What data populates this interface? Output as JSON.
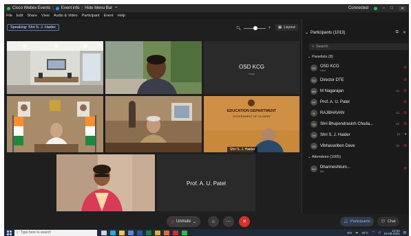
{
  "titlebar": {
    "app_title": "Cisco Webex Events",
    "event_info": "Event info",
    "hide_menu": "Hide Menu Bar",
    "status": "Connected",
    "minimize": "–",
    "maximize": "□",
    "close": "✕"
  },
  "menu": [
    "File",
    "Edit",
    "Share",
    "View",
    "Audio & Video",
    "Participant",
    "Event",
    "Help"
  ],
  "speaking": "Speaking: Shri S. J. Haider",
  "layout_label": "Layout",
  "tiles": {
    "osd_name": "OSD KCG",
    "osd_sub": "Host",
    "edu_line1": "EDUCATION DEPARTMENT",
    "edu_line2": "GOVERNMENT OF GUJARAT",
    "haider_tag": "Shri S. J. Haider",
    "patel_name": "Prof. A. U. Patel"
  },
  "participants": {
    "title": "Participants (1013)",
    "search_placeholder": "Search",
    "panelists_title": "Panelists (8)",
    "attendees_title": "Attendees (1005)",
    "panelists": [
      {
        "initials": "OK",
        "name": "OSD KCG",
        "sub": "Host"
      },
      {
        "initials": "DD",
        "name": "Director DTE",
        "sub": ""
      },
      {
        "initials": "MN",
        "name": "M Nagarajan",
        "sub": ""
      },
      {
        "initials": "PP",
        "name": "Prof. A. U. Patel",
        "sub": ""
      },
      {
        "initials": "R",
        "name": "RAJBHAVAN",
        "sub": ""
      },
      {
        "initials": "SS",
        "name": "Shri Bhupendrasinh Chuda...",
        "sub": ""
      },
      {
        "initials": "SH",
        "name": "Shri S. J. Haider",
        "sub": ""
      },
      {
        "initials": "VD",
        "name": "Vibhavariben Dave",
        "sub": ""
      }
    ],
    "attendees": [
      {
        "initials": "DY",
        "name": "Dharmeshkum...",
        "sub": "Me"
      }
    ]
  },
  "controls": {
    "unmute": "Unmute",
    "participants_btn": "Participants",
    "chat_btn": "Chat"
  },
  "taskbar": {
    "search_placeholder": "Type here to search",
    "lang": "EN",
    "temp": "30°C",
    "time": "12:04",
    "date": "04-09-2021"
  },
  "colors": {
    "accent": "#2d8cff",
    "end": "#d93025",
    "mic_off": "#e0382e"
  }
}
